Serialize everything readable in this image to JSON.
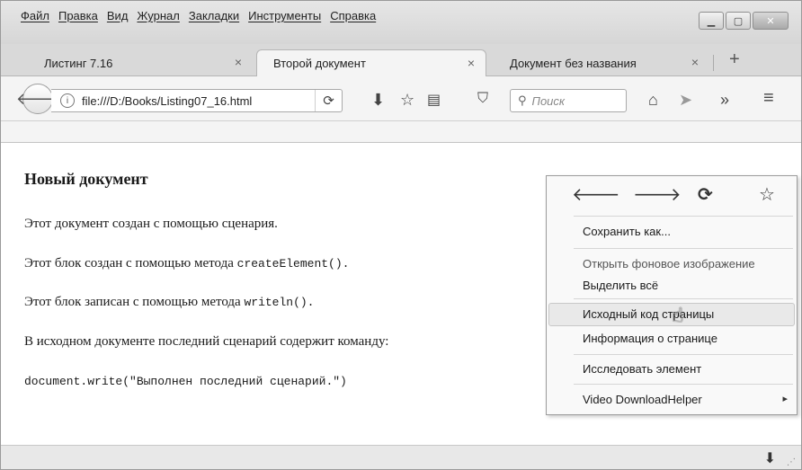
{
  "menu": [
    "Файл",
    "Правка",
    "Вид",
    "Журнал",
    "Закладки",
    "Инструменты",
    "Справка"
  ],
  "window_controls": {
    "minimize": "▁",
    "maximize": "▢",
    "close": "✕"
  },
  "tabs": [
    {
      "label": "Листинг 7.16",
      "close": "×"
    },
    {
      "label": "Второй документ",
      "close": "×"
    },
    {
      "label": "Документ без названия",
      "close": "×"
    }
  ],
  "new_tab": "+",
  "nav": {
    "url": "file:///D:/Books/Listing07_16.html",
    "search_placeholder": "Поиск",
    "icons": [
      "download-icon",
      "bookmark-star-icon",
      "library-icon",
      "pocket-icon",
      "home-icon",
      "send-icon",
      "overflow-icon",
      "hamburger-menu-icon"
    ]
  },
  "content": {
    "heading": "Новый документ",
    "p1": "Этот документ создан с помощью сценария.",
    "p2_prefix": "Этот блок создан с помощью метода ",
    "p2_code": "createElement().",
    "p3_prefix": "Этот блок записан с помощью метода ",
    "p3_code": "writeln().",
    "p4": "В исходном документе последний сценарий содержит команду:",
    "code_line": "document.write(\"Выполнен последний сценарий.\")"
  },
  "context_menu": {
    "items": [
      "Сохранить как...",
      "Открыть фоновое изображение",
      "Выделить всё",
      "Исходный код страницы",
      "Информация о странице",
      "Исследовать элемент",
      "Video DownloadHelper"
    ],
    "submenu_arrow": "▸",
    "highlighted": "Исходный код страницы"
  }
}
